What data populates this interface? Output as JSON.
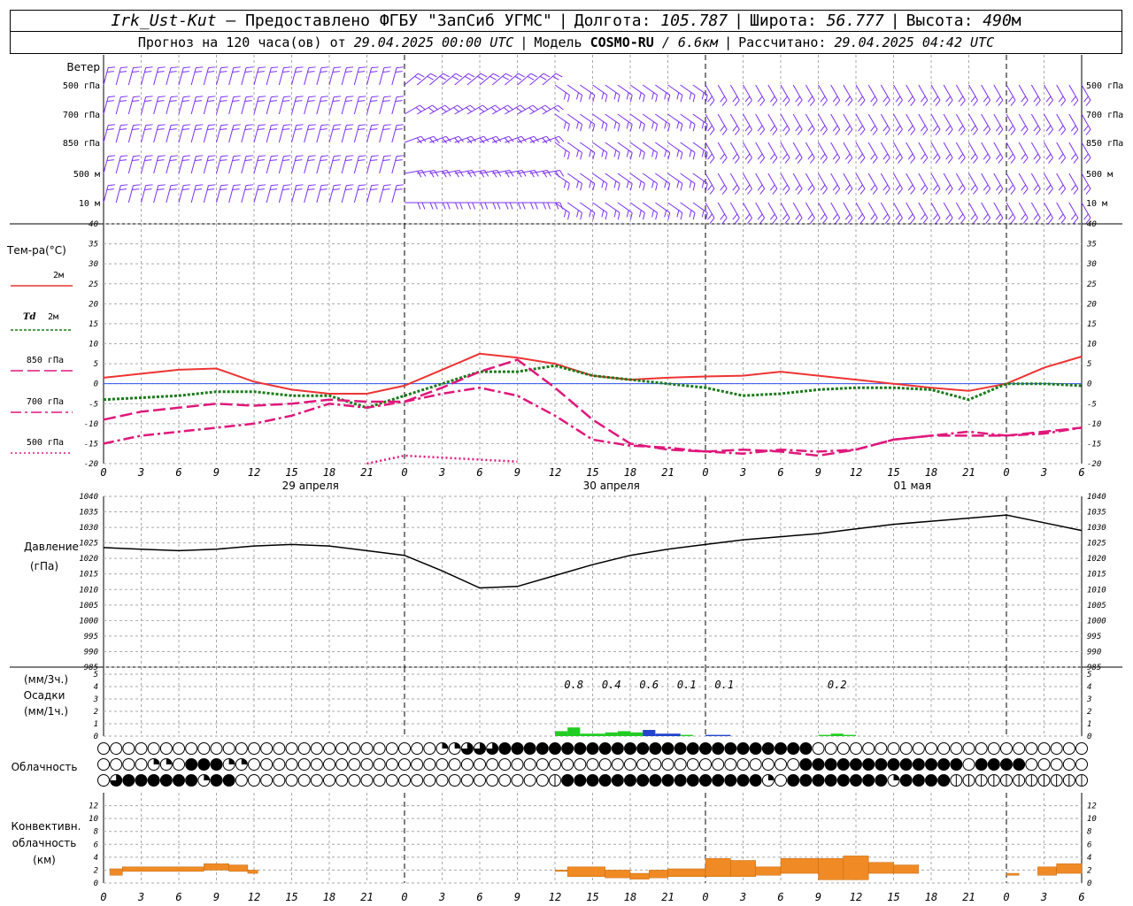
{
  "header": {
    "station": "Irk_Ust-Kut",
    "provider": "– Предоставлено ФГБУ \"ЗапСиб УГМС\"",
    "lon_label": "Долгота:",
    "lon": "105.787",
    "lat_label": "Широта:",
    "lat": "56.777",
    "alt_label": "Высота:",
    "alt": "490",
    "alt_unit": "м",
    "forecast_label": "Прогноз на 120 часа(ов) от",
    "forecast_start": "29.04.2025 00:00 UTC",
    "model_label": "Модель",
    "model": "COSMO-RU",
    "model_res": "/ 6.6км",
    "computed_label": "Рассчитано:",
    "computed": "29.04.2025 04:42 UTC"
  },
  "chart_data": [
    {
      "type": "wind_barbs",
      "title": "Ветер",
      "levels": [
        "500 гПа",
        "700 гПа",
        "850 гПа",
        "500 м",
        "10 м"
      ],
      "color": "#7b2ff7"
    },
    {
      "type": "line",
      "title": "Тем-ра(°С)",
      "ylim": [
        -20,
        40
      ],
      "yticks": [
        -20,
        -15,
        -10,
        -5,
        0,
        5,
        10,
        15,
        20,
        25,
        30,
        35,
        40
      ],
      "x_hours": [
        0,
        3,
        6,
        9,
        12,
        15,
        18,
        21,
        24,
        27,
        30,
        33,
        36,
        39,
        42,
        45,
        48,
        51,
        54,
        57,
        60,
        63,
        66,
        69,
        72,
        75,
        78
      ],
      "series": [
        {
          "name": "2м",
          "color": "#ee3333",
          "dash": "solid",
          "values": [
            1.5,
            2.5,
            3.5,
            3.8,
            0.5,
            -1.5,
            -2.5,
            -2.5,
            -0.5,
            3.5,
            7.5,
            6.5,
            5,
            2,
            1,
            1.5,
            1.8,
            2,
            3,
            2,
            1,
            0,
            -1,
            -1.8,
            0,
            4,
            6.8
          ]
        },
        {
          "name": "Td 2м",
          "color": "#1a7a1a",
          "dash": "dotted",
          "values": [
            -4,
            -3.5,
            -3,
            -2,
            -2,
            -3,
            -3,
            -6,
            -3,
            0,
            3,
            3,
            4.5,
            2,
            1,
            0,
            -1,
            -3,
            -2.5,
            -1.5,
            -1,
            -1,
            -1.5,
            -4,
            0,
            0,
            -0.5
          ]
        },
        {
          "name": "850 гПа",
          "color": "#e0177a",
          "dash": "longdash",
          "values": [
            -9,
            -7,
            -6,
            -5,
            -5.5,
            -5,
            -4,
            -4.5,
            -4.5,
            -1,
            3,
            6,
            -1,
            -9,
            -15,
            -16.5,
            -17,
            -16.5,
            -17,
            -18,
            -16.5,
            -14,
            -13,
            -13,
            -13,
            -12,
            -11
          ]
        },
        {
          "name": "700 гПа",
          "color": "#e0177a",
          "dash": "dashdot",
          "values": [
            -15,
            -13,
            -12,
            -11,
            -10,
            -8,
            -5,
            -6,
            -4.5,
            -2.5,
            -1,
            -3,
            -8,
            -14,
            -15.5,
            -16,
            -17,
            -17.5,
            -16.5,
            -17,
            -16.5,
            -14,
            -13,
            -12,
            -13,
            -12.5,
            -11
          ]
        },
        {
          "name": "500 гПа",
          "color": "#e0177a",
          "dash": "dot",
          "values": [
            null,
            null,
            null,
            null,
            null,
            null,
            null,
            -20,
            -18,
            -18.5,
            -19,
            -19.5,
            null,
            null,
            null,
            null,
            null,
            null,
            null,
            null,
            null,
            null,
            null,
            null,
            null,
            null,
            null
          ]
        }
      ]
    },
    {
      "type": "line",
      "title": "Давление (гПа)",
      "ylim": [
        985,
        1040
      ],
      "yticks": [
        985,
        990,
        995,
        1000,
        1005,
        1010,
        1015,
        1020,
        1025,
        1030,
        1035,
        1040
      ],
      "series": [
        {
          "name": "Давление",
          "color": "#000000",
          "values": [
            1023.5,
            1023,
            1022.5,
            1023,
            1024,
            1024.5,
            1024,
            1022.5,
            1021,
            1016,
            1010.5,
            1011,
            1014.5,
            1018,
            1021,
            1023,
            1024.5,
            1026,
            1027,
            1028,
            1029.5,
            1031,
            1032,
            1033,
            1034,
            1031.5,
            1029
          ]
        }
      ]
    },
    {
      "type": "bar",
      "title": "Осадки",
      "ylabels": [
        "(мм/3ч.)",
        "Осадки",
        "(мм/1ч.)"
      ],
      "ylim": [
        0,
        5
      ],
      "yticks": [
        0,
        1,
        2,
        3,
        4,
        5
      ],
      "annotations": [
        {
          "hour": 37.5,
          "text": "0.8"
        },
        {
          "hour": 40.5,
          "text": "0.4"
        },
        {
          "hour": 43.5,
          "text": "0.6"
        },
        {
          "hour": 46.5,
          "text": "0.1"
        },
        {
          "hour": 49.5,
          "text": "0.1"
        },
        {
          "hour": 58.5,
          "text": "0.2"
        }
      ],
      "bars": [
        {
          "hour": 36.5,
          "value": 0.4,
          "color": "#22cc22"
        },
        {
          "hour": 37.5,
          "value": 0.7,
          "color": "#22cc22"
        },
        {
          "hour": 38.5,
          "value": 0.2,
          "color": "#22cc22"
        },
        {
          "hour": 39.5,
          "value": 0.2,
          "color": "#22cc22"
        },
        {
          "hour": 40.5,
          "value": 0.3,
          "color": "#22cc22"
        },
        {
          "hour": 41.5,
          "value": 0.4,
          "color": "#22cc22"
        },
        {
          "hour": 42.5,
          "value": 0.3,
          "color": "#22cc22"
        },
        {
          "hour": 43.5,
          "value": 0.5,
          "color": "#2244cc"
        },
        {
          "hour": 44.5,
          "value": 0.2,
          "color": "#2244cc"
        },
        {
          "hour": 45.5,
          "value": 0.2,
          "color": "#2244cc"
        },
        {
          "hour": 46.5,
          "value": 0.1,
          "color": "#22cc22"
        },
        {
          "hour": 48.5,
          "value": 0.1,
          "color": "#2244cc"
        },
        {
          "hour": 49.5,
          "value": 0.1,
          "color": "#2244cc"
        },
        {
          "hour": 57.5,
          "value": 0.1,
          "color": "#22cc22"
        },
        {
          "hour": 58.5,
          "value": 0.2,
          "color": "#22cc22"
        },
        {
          "hour": 59.5,
          "value": 0.1,
          "color": "#22cc22"
        }
      ]
    },
    {
      "type": "table",
      "title": "Облачность",
      "rows": [
        "0000000000000000000000000002233344444444444444444444444440000000000000000000000000000000000000001212213121200000",
        "0000220444220000000000000000000000000000000000000000000044444444444440444400000044440000000044444441444020010000002233304222443",
        "0344444424400000000000000000000000001444444444444444420444444442444411111111111111112221111112000000000000222222111022444"
      ]
    },
    {
      "type": "bar",
      "title": "Конвективн. облачность (км)",
      "ylim": [
        0,
        14
      ],
      "yticks": [
        0,
        2,
        4,
        6,
        8,
        10,
        12
      ],
      "bars": [
        {
          "from": 0.5,
          "to": 1.5,
          "base": 1.2,
          "top": 2.2
        },
        {
          "from": 1.5,
          "to": 8,
          "base": 1.8,
          "top": 2.5
        },
        {
          "from": 8,
          "to": 10,
          "base": 2.0,
          "top": 3.0
        },
        {
          "from": 10,
          "to": 11.5,
          "base": 1.8,
          "top": 2.8
        },
        {
          "from": 11.5,
          "to": 12.3,
          "base": 1.5,
          "top": 2.0
        },
        {
          "from": 36,
          "to": 37,
          "base": 1.8,
          "top": 2.0
        },
        {
          "from": 37,
          "to": 40,
          "base": 1.0,
          "top": 2.5
        },
        {
          "from": 40,
          "to": 42,
          "base": 0.8,
          "top": 2.0
        },
        {
          "from": 42,
          "to": 43.5,
          "base": 0.6,
          "top": 1.5
        },
        {
          "from": 43.5,
          "to": 45,
          "base": 0.8,
          "top": 2.0
        },
        {
          "from": 45,
          "to": 48,
          "base": 1.0,
          "top": 2.2
        },
        {
          "from": 48,
          "to": 50,
          "base": 1.0,
          "top": 3.8
        },
        {
          "from": 50,
          "to": 52,
          "base": 1.0,
          "top": 3.5
        },
        {
          "from": 52,
          "to": 54,
          "base": 1.2,
          "top": 2.5
        },
        {
          "from": 54,
          "to": 57,
          "base": 1.5,
          "top": 3.8
        },
        {
          "from": 57,
          "to": 59,
          "base": 0.5,
          "top": 3.8
        },
        {
          "from": 59,
          "to": 61,
          "base": 0.5,
          "top": 4.2
        },
        {
          "from": 61,
          "to": 63,
          "base": 1.5,
          "top": 3.2
        },
        {
          "from": 63,
          "to": 65,
          "base": 1.5,
          "top": 2.8
        },
        {
          "from": 72,
          "to": 73,
          "base": 1.2,
          "top": 1.5
        },
        {
          "from": 74.5,
          "to": 76,
          "base": 1.2,
          "top": 2.5
        },
        {
          "from": 76,
          "to": 78,
          "base": 1.5,
          "top": 3.0
        }
      ]
    }
  ],
  "axis": {
    "x_ticks": [
      "0",
      "3",
      "6",
      "9",
      "12",
      "15",
      "18",
      "21",
      "0",
      "3",
      "6",
      "9",
      "12",
      "15",
      "18",
      "21",
      "0",
      "3",
      "6",
      "9",
      "12",
      "15",
      "18",
      "21",
      "0",
      "3",
      "6"
    ],
    "days": [
      {
        "hour": 16.5,
        "label": "29 апреля"
      },
      {
        "hour": 40.5,
        "label": "30 апреля"
      },
      {
        "hour": 64.5,
        "label": "01 мая"
      }
    ]
  },
  "legend": {
    "temp_title": "Тем-ра(°С)",
    "t2m": "2м",
    "td_prefix": "Td",
    "td_suffix": "2м",
    "t850": "850 гПа",
    "t700": "700 гПа",
    "t500": "500 гПа",
    "pressure_1": "Давление",
    "pressure_2": "(гПа)",
    "precip_1": "(мм/3ч.)",
    "precip_2": "Осадки",
    "precip_3": "(мм/1ч.)",
    "cloud": "Облачность",
    "conv_1": "Конвективн.",
    "conv_2": "облачность",
    "conv_3": "(км)",
    "wind": "Ветер",
    "wind_levels": [
      "500 гПа",
      "700 гПа",
      "850 гПа",
      "500 м",
      "10 м"
    ]
  }
}
